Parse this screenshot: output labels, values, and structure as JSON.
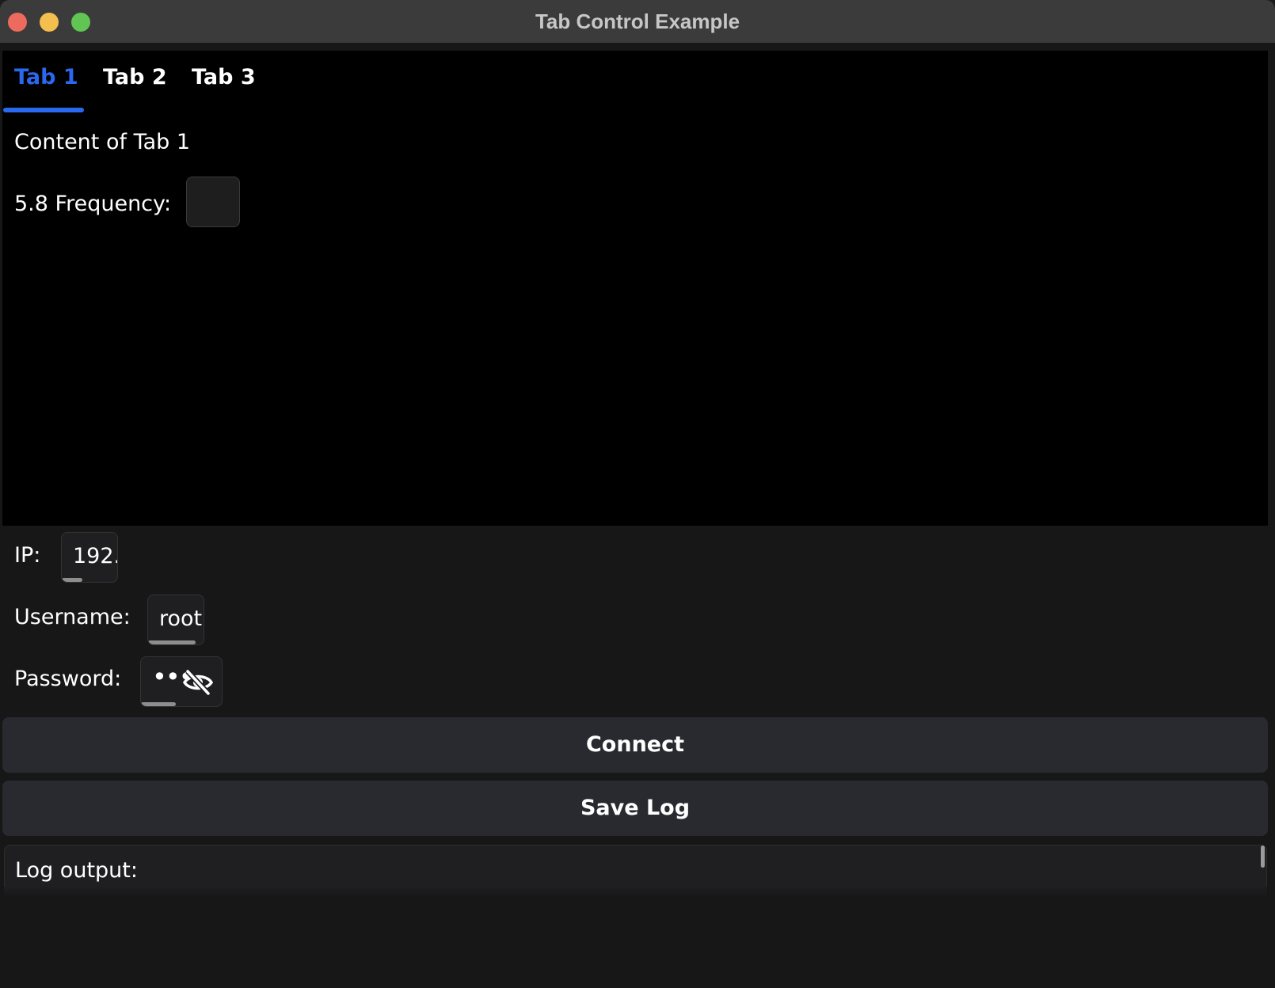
{
  "window": {
    "title": "Tab Control Example"
  },
  "tabs": [
    {
      "label": "Tab 1",
      "active": true
    },
    {
      "label": "Tab 2",
      "active": false
    },
    {
      "label": "Tab 3",
      "active": false
    }
  ],
  "tab_content": {
    "text": "Content of Tab 1",
    "frequency_label": "5.8 Frequency:",
    "frequency_checked": false
  },
  "form": {
    "ip_label": "IP:",
    "ip_value": "192.",
    "username_label": "Username:",
    "username_value": "root",
    "password_label": "Password:",
    "password_value": "•••"
  },
  "buttons": {
    "connect_label": "Connect",
    "save_log_label": "Save Log"
  },
  "log": {
    "label": "Log output:"
  },
  "colors": {
    "accent": "#2a68f0",
    "button_bg": "#282a30",
    "tab_panel_bg": "#000000",
    "window_bg": "#171718"
  },
  "icons": {
    "password_toggle": "eye-slash-icon"
  }
}
